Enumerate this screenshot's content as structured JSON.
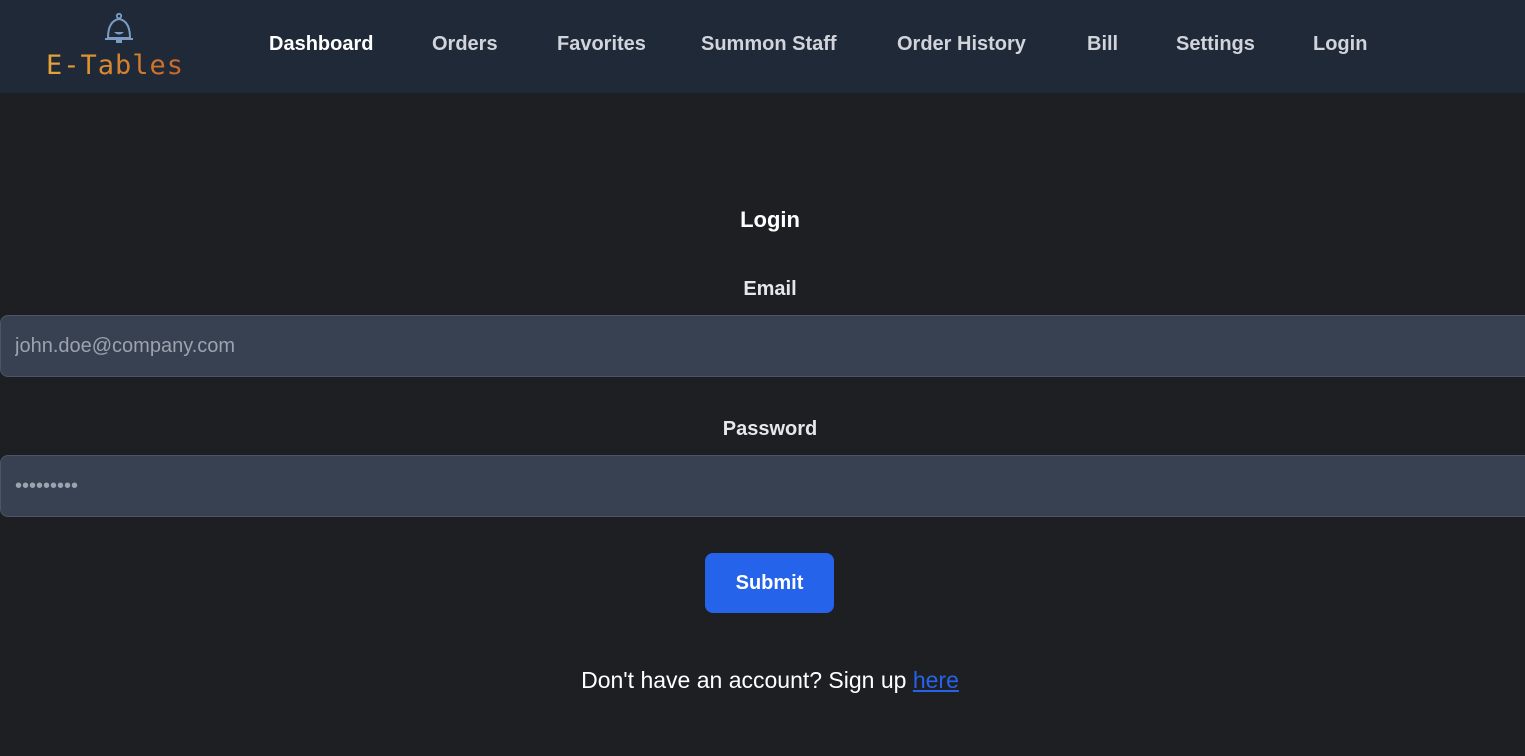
{
  "brand": {
    "name": "E-Tables",
    "icon": "bell-icon",
    "colors": {
      "start": "#e6a53a",
      "end": "#c9672a",
      "bell": "#7b9cc4"
    }
  },
  "nav": {
    "items": [
      {
        "label": "Dashboard",
        "active": true
      },
      {
        "label": "Orders",
        "active": false
      },
      {
        "label": "Favorites",
        "active": false
      },
      {
        "label": "Summon Staff",
        "active": false
      },
      {
        "label": "Order History",
        "active": false
      },
      {
        "label": "Bill",
        "active": false
      },
      {
        "label": "Settings",
        "active": false
      },
      {
        "label": "Login",
        "active": false
      }
    ]
  },
  "login_form": {
    "title": "Login",
    "email": {
      "label": "Email",
      "placeholder": "john.doe@company.com",
      "value": ""
    },
    "password": {
      "label": "Password",
      "placeholder": "•••••••••",
      "value": ""
    },
    "submit_label": "Submit",
    "signup_prompt": "Don't have an account? Sign up ",
    "signup_link": "here"
  },
  "colors": {
    "page_bg": "#1e1f23",
    "navbar_bg": "#1f2937",
    "input_bg": "#374151",
    "accent": "#2563eb"
  }
}
